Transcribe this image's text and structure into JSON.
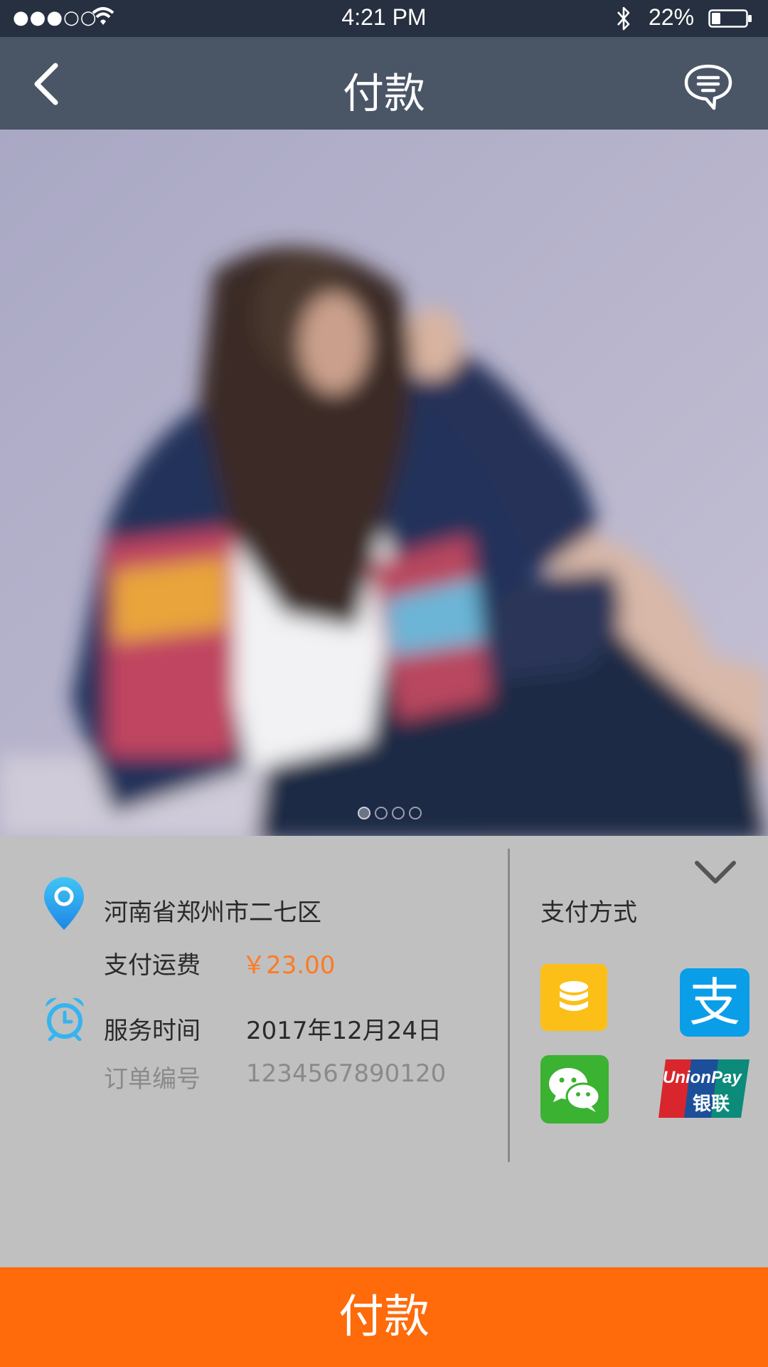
{
  "status_bar": {
    "signal": "●●●○○",
    "time": "4:21 PM",
    "battery": "22%"
  },
  "nav": {
    "title": "付款"
  },
  "carousel": {
    "pages": 4,
    "active_page": 1
  },
  "info": {
    "address": "河南省郑州市二七区",
    "shipping_label": "支付运费",
    "shipping_value": "￥23.00",
    "service_time_label": "服务时间",
    "service_time_value": "2017年12月24日",
    "order_no_label": "订单编号",
    "order_no_value": "1234567890120"
  },
  "payment": {
    "title": "支付方式",
    "methods": [
      {
        "icon": "coins-icon",
        "color": "#fbbf17"
      },
      {
        "icon": "alipay-icon",
        "color": "#0a9ee9"
      },
      {
        "icon": "wechat-pay-icon",
        "color": "#3bb231"
      },
      {
        "icon": "unionpay-icon",
        "color": "#d8262c"
      }
    ],
    "alipay_glyph": "支",
    "unionpay_text": "UnionPay",
    "unionpay_cn": "银联"
  },
  "footer": {
    "pay_button": "付款"
  },
  "colors": {
    "status_bar_bg": "#273040",
    "nav_bg": "#4a5566",
    "panel_bg": "#c0c0c0",
    "accent": "#ff6a0a",
    "price": "#ff7a22",
    "icon_blue": "#2ea7f0"
  }
}
